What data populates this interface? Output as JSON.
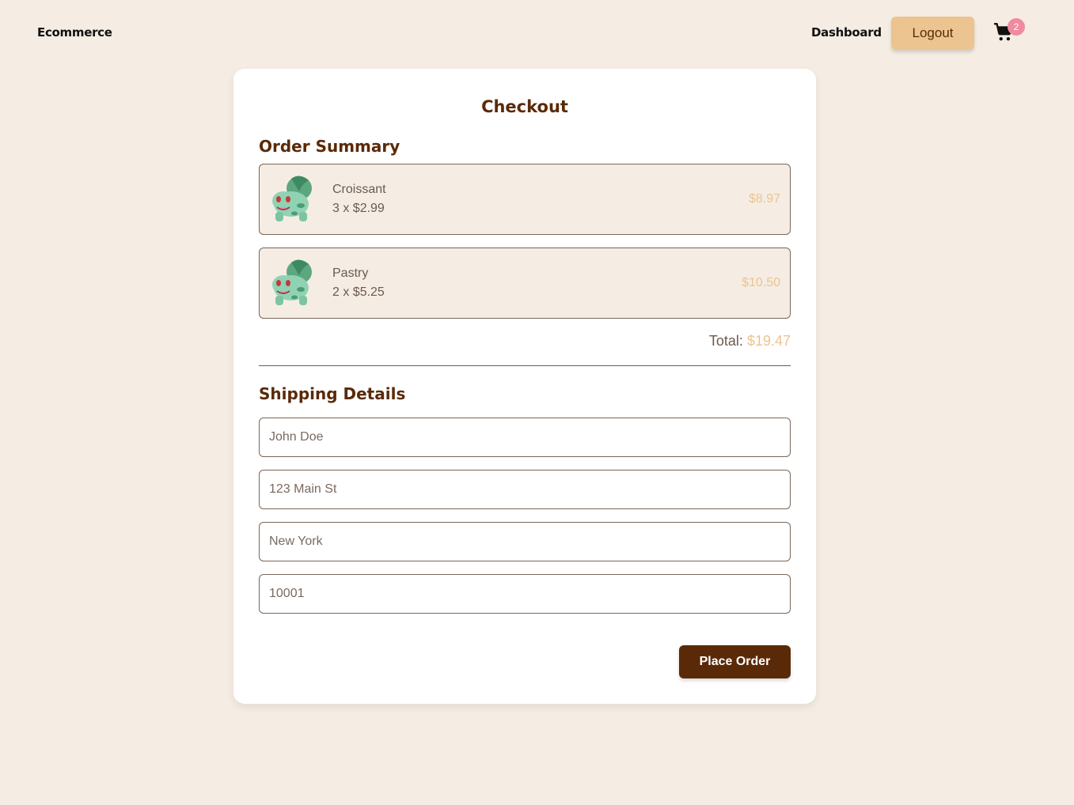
{
  "navbar": {
    "brand": "Ecommerce",
    "dashboard_link": "Dashboard",
    "logout_label": "Logout",
    "cart_icon": "shopping-cart-icon",
    "cart_count": "2"
  },
  "checkout": {
    "title": "Checkout",
    "order_summary_title": "Order Summary",
    "items": [
      {
        "name": "Croissant",
        "qty_line": "3 x $2.99",
        "line_total": "$8.97",
        "image": "bulbasaur-image"
      },
      {
        "name": "Pastry",
        "qty_line": "2 x $5.25",
        "line_total": "$10.50",
        "image": "bulbasaur-image"
      }
    ],
    "total_label": "Total:",
    "total_value": "$19.47",
    "shipping_title": "Shipping Details",
    "fields": {
      "name_placeholder": "John Doe",
      "address_placeholder": "123 Main St",
      "city_placeholder": "New York",
      "zip_placeholder": "10001"
    },
    "place_order_label": "Place Order"
  },
  "colors": {
    "background": "#f5ede3",
    "accent": "#ebc48f",
    "brand_dark": "#5a2a08",
    "badge": "#f08aa0"
  }
}
